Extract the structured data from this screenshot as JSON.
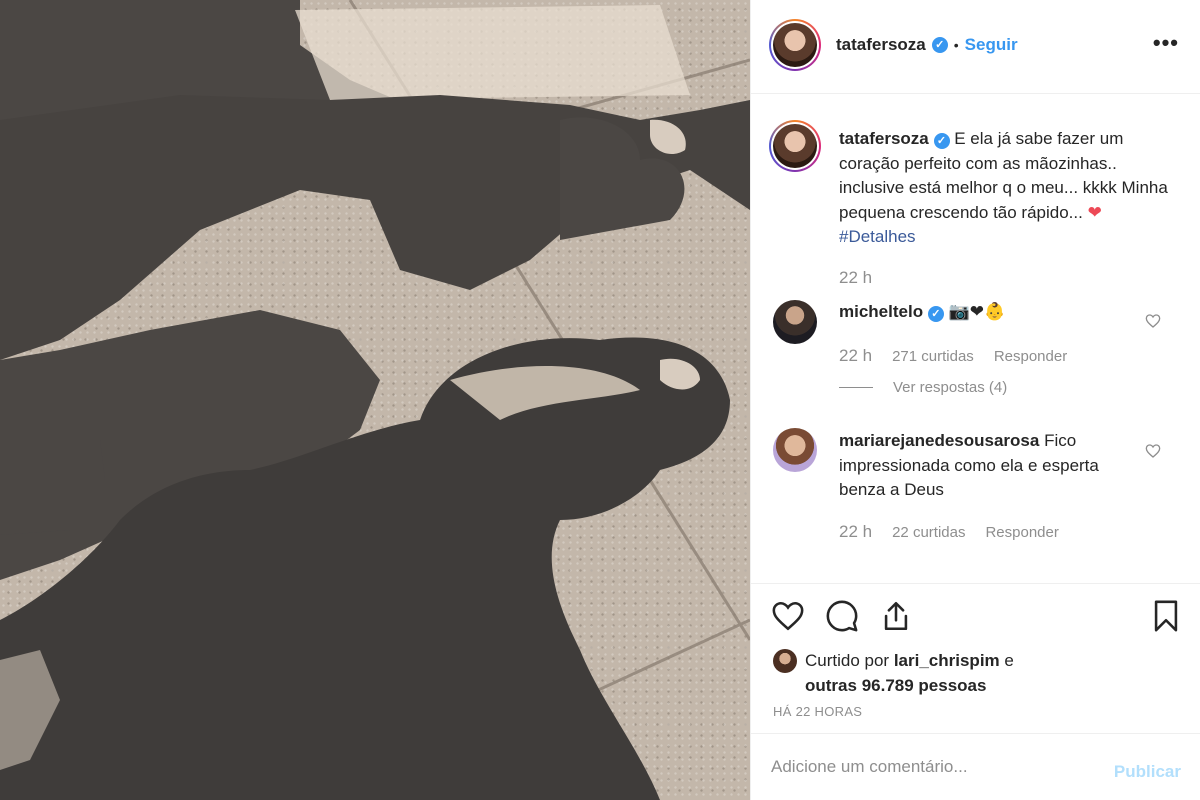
{
  "post": {
    "photo_alt": "Sombra de mãe e filha fazendo coração com as mãos",
    "author": {
      "username": "tatafersoza",
      "verified": true,
      "separator": "•",
      "follow_label": "Seguir"
    },
    "more_label": "•••",
    "caption": {
      "username": "tatafersoza",
      "text": "E ela já sabe fazer um coração perfeito com as mãozinhas.. inclusive está melhor q o meu... kkkk Minha pequena crescendo tão rápido...",
      "emoji": "❤",
      "hashtag": "#Detalhes",
      "time": "22 h"
    },
    "comments": [
      {
        "username": "micheltelo",
        "verified": true,
        "text": "📷❤👶",
        "time": "22 h",
        "likes": "271 curtidas",
        "reply_label": "Responder",
        "view_replies": "Ver respostas (4)"
      },
      {
        "username": "mariarejanedesousarosa",
        "verified": false,
        "text": "Fico impressionada como ela e esperta benza a Deus",
        "time": "22 h",
        "likes": "22 curtidas",
        "reply_label": "Responder"
      }
    ],
    "liked_by": {
      "prefix": "Curtido por ",
      "user": "lari_chrispim",
      "mid": " e",
      "others_prefix": "outras ",
      "count": "96.789",
      "suffix": " pessoas"
    },
    "posted_ago": "HÁ 22 HORAS",
    "add_comment": {
      "placeholder": "Adicione um comentário...",
      "publish_label": "Publicar"
    }
  },
  "colors": {
    "link": "#3897f0",
    "muted": "#8e8e8e",
    "publish_disabled": "#b2dffc",
    "heart": "#ed4956"
  },
  "icons": [
    "heart-outline-icon",
    "comment-icon",
    "share-icon",
    "bookmark-icon",
    "verified-badge-icon",
    "more-options-icon"
  ]
}
